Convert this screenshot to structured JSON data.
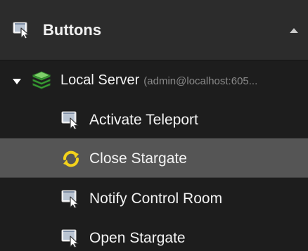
{
  "header": {
    "title": "Buttons",
    "icon": "cursor-window-icon",
    "collapse_icon": "chevron-up-icon"
  },
  "tree": {
    "server": {
      "label": "Local Server",
      "detail": "(admin@localhost:605...",
      "icon": "server-stack-icon",
      "expanded": true
    },
    "items": [
      {
        "label": "Activate Teleport",
        "icon": "cursor-window-icon",
        "selected": false
      },
      {
        "label": "Close Stargate",
        "icon": "refresh-sync-icon",
        "selected": true
      },
      {
        "label": "Notify Control Room",
        "icon": "cursor-window-icon",
        "selected": false
      },
      {
        "label": "Open Stargate",
        "icon": "cursor-window-icon",
        "selected": false
      }
    ]
  },
  "colors": {
    "header_bg": "#2c2c2c",
    "panel_bg": "#1d1d1d",
    "selected_bg": "#555555",
    "text": "#f3f3f3",
    "muted_text": "#8a8a8a",
    "server_green": "#3fae3a",
    "sync_yellow": "#f3d21b"
  }
}
